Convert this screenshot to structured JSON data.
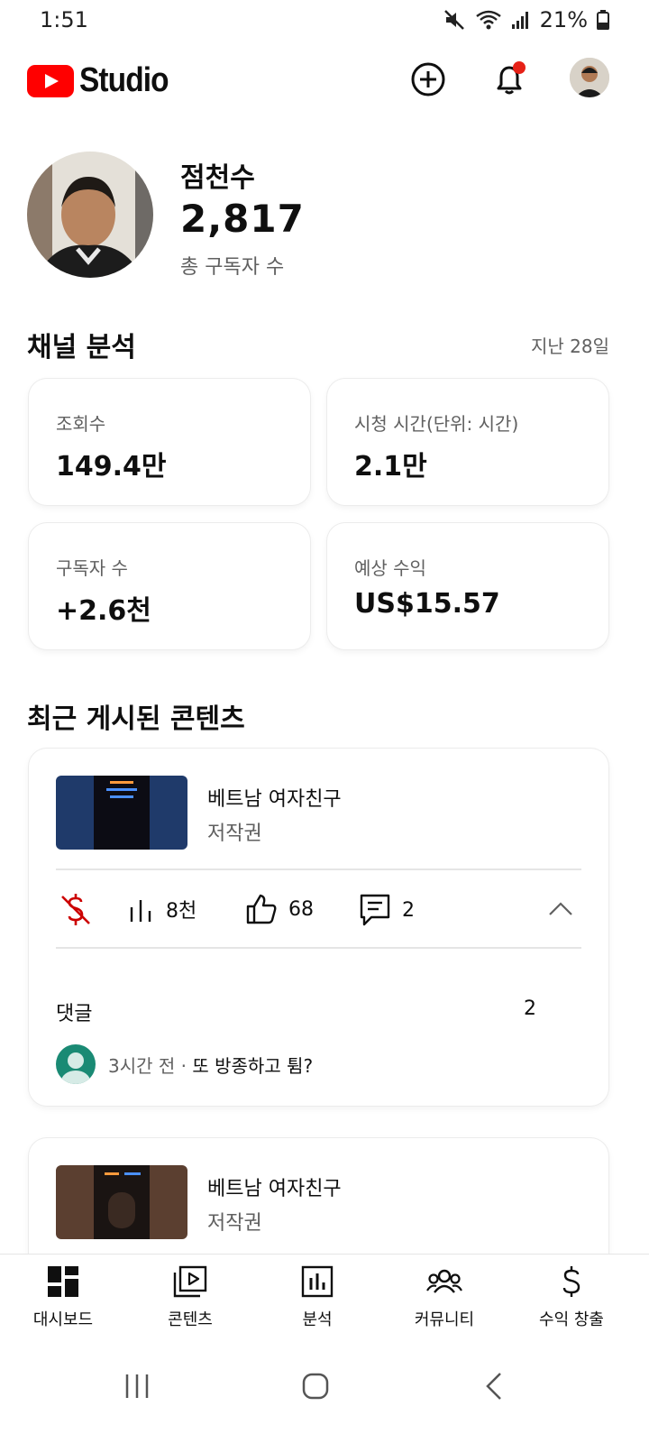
{
  "status_bar": {
    "time": "1:51",
    "battery": "21%"
  },
  "app": {
    "name": "Studio"
  },
  "channel": {
    "name": "점천수",
    "subscribers": "2,817",
    "subscribers_label": "총 구독자 수"
  },
  "analytics": {
    "title": "채널 분석",
    "period": "지난 28일",
    "metrics": [
      {
        "label": "조회수",
        "value": "149.4만"
      },
      {
        "label": "시청 시간(단위: 시간)",
        "value": "2.1만"
      },
      {
        "label": "구독자 수",
        "value": "+2.6천"
      },
      {
        "label": "예상 수익",
        "value": "US$15.57"
      }
    ]
  },
  "recent": {
    "title": "최근 게시된 콘텐츠",
    "items": [
      {
        "title": "베트남 여자친구",
        "subtitle": "저작권",
        "thumb_color": "#1f3a6a",
        "views": "8천",
        "likes": "68",
        "comments": "2",
        "comments_label": "댓글",
        "comments_count": "2",
        "latest_comment_time": "3시간 전 · ",
        "latest_comment_text": "또 방종하고 튐?"
      },
      {
        "title": "베트남 여자친구",
        "subtitle": "저작권",
        "thumb_color": "#5b3f30"
      }
    ]
  },
  "bottom_nav": [
    {
      "label": "대시보드",
      "icon": "dashboard-icon"
    },
    {
      "label": "콘텐츠",
      "icon": "content-icon"
    },
    {
      "label": "분석",
      "icon": "analytics-icon"
    },
    {
      "label": "커뮤니티",
      "icon": "community-icon"
    },
    {
      "label": "수익 창출",
      "icon": "earn-icon"
    }
  ],
  "colors": {
    "brand_red": "#ff0000",
    "notification_dot": "#e62117",
    "monetization_off": "#cc0000",
    "text_secondary": "#606060"
  }
}
